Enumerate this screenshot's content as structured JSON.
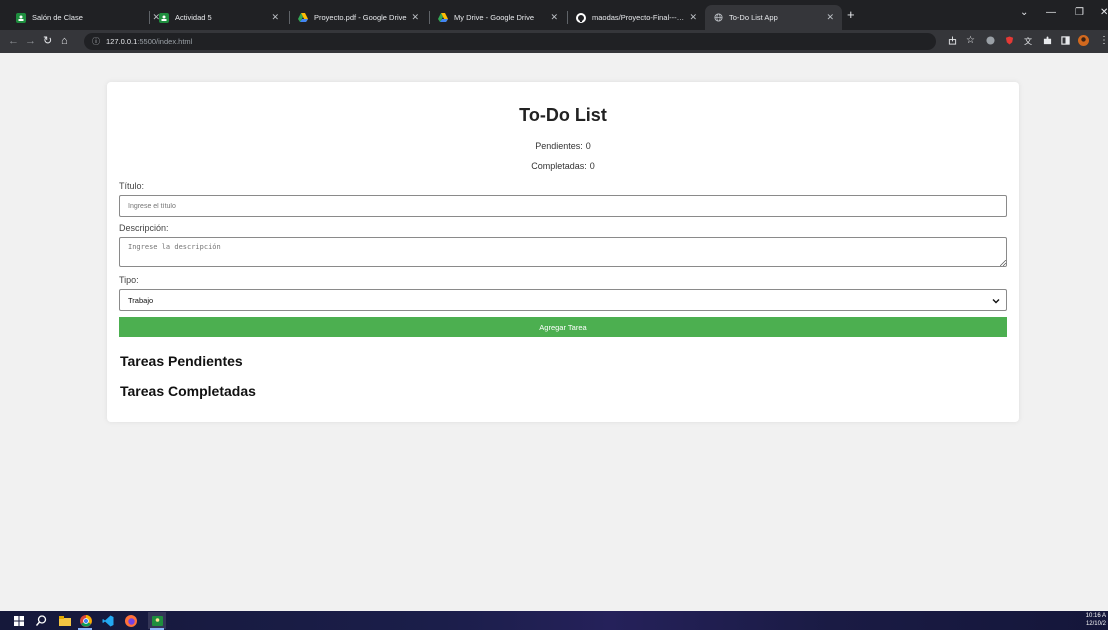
{
  "browser": {
    "tabs": [
      {
        "title": "Salón de Clase",
        "icon": "classroom-icon"
      },
      {
        "title": "Actividad 5",
        "icon": "classroom-icon"
      },
      {
        "title": "Proyecto.pdf - Google Drive",
        "icon": "google-drive-icon"
      },
      {
        "title": "My Drive - Google Drive",
        "icon": "google-drive-icon"
      },
      {
        "title": "maodas/Proyecto-Final---Aplica",
        "icon": "github-icon"
      },
      {
        "title": "To-Do List App",
        "icon": "globe-icon",
        "active": true
      }
    ],
    "url_host": "127.0.0.1",
    "url_path": ":5500/index.html"
  },
  "app": {
    "title": "To-Do List",
    "pending_label": "Pendientes:",
    "pending_count": "0",
    "completed_label": "Completadas:",
    "completed_count": "0",
    "title_label": "Título:",
    "title_placeholder": "Ingrese el título",
    "description_label": "Descripción:",
    "description_placeholder": "Ingrese la descripción",
    "type_label": "Tipo:",
    "type_selected": "Trabajo",
    "add_button": "Agregar Tarea",
    "pending_heading": "Tareas Pendientes",
    "completed_heading": "Tareas Completadas"
  },
  "taskbar": {
    "clock_time": "10:16 A",
    "clock_date": "12/10/2"
  },
  "colors": {
    "add_button": "#4caf50",
    "browser_frame": "#202124",
    "toolbar": "#35363a",
    "page_background": "#f1f1f1"
  }
}
